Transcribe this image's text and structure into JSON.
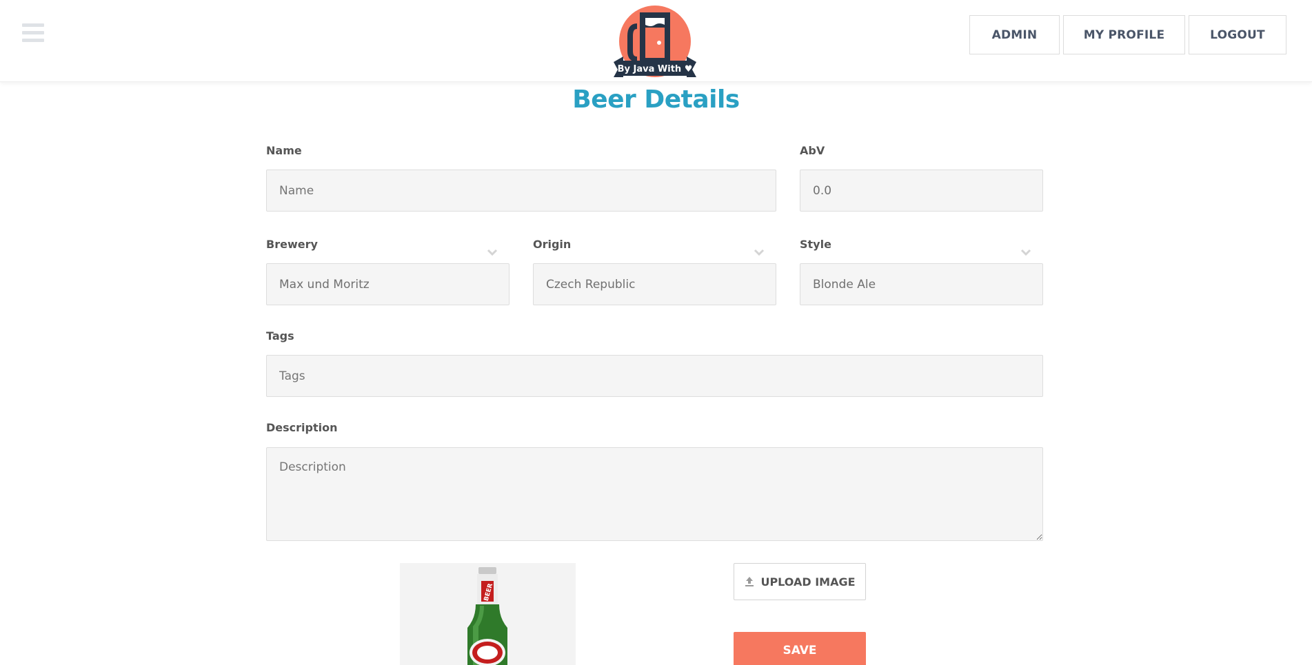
{
  "header": {
    "logo_text": "By Java With ♥",
    "nav": {
      "admin": "ADMIN",
      "profile": "MY PROFILE",
      "logout": "LOGOUT"
    }
  },
  "page": {
    "title": "Beer Details"
  },
  "form": {
    "name": {
      "label": "Name",
      "placeholder": "Name",
      "value": ""
    },
    "abv": {
      "label": "AbV",
      "value": "0.0"
    },
    "brewery": {
      "label": "Brewery",
      "value": "Max und Moritz"
    },
    "origin": {
      "label": "Origin",
      "value": "Czech Republic"
    },
    "style": {
      "label": "Style",
      "value": "Blonde Ale"
    },
    "tags": {
      "label": "Tags",
      "placeholder": "Tags"
    },
    "description": {
      "label": "Description",
      "placeholder": "Description"
    }
  },
  "actions": {
    "upload_label": "UPLOAD IMAGE",
    "save_label": "SAVE"
  },
  "colors": {
    "accent": "#2aa0c3",
    "brand": "#f6785f",
    "navy": "#253447"
  },
  "icons": {
    "menu": "hamburger-icon",
    "upload": "upload-icon",
    "dropdown": "chevron-down-icon"
  }
}
